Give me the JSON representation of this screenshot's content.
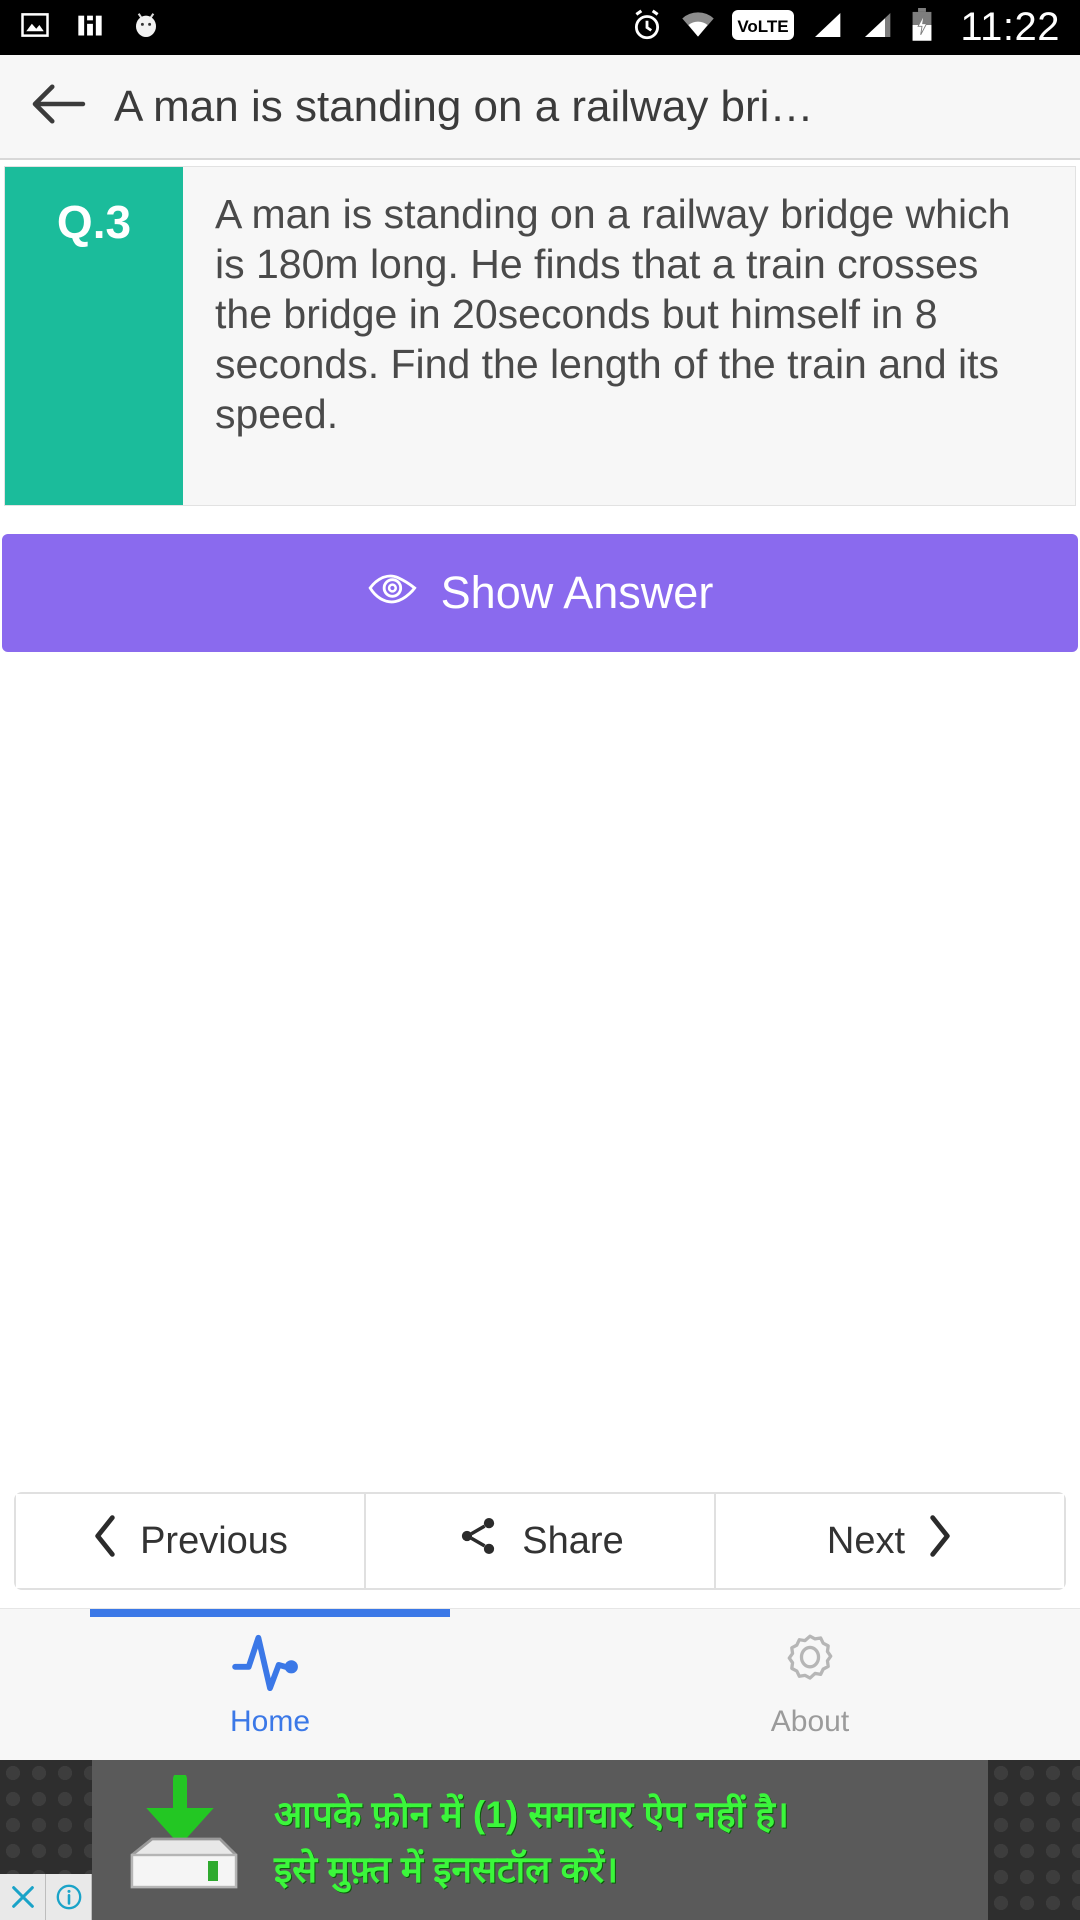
{
  "status_bar": {
    "time": "11:22",
    "left_icons": [
      "image-icon",
      "chart-icon",
      "android-mascot-icon"
    ],
    "right_icons": [
      "alarm-icon",
      "wifi-icon",
      "volte-icon",
      "signal-bars-1-icon",
      "signal-bars-2-icon",
      "battery-charging-icon"
    ],
    "volte_label": "VoLTE"
  },
  "header": {
    "back_icon": "arrow-left-icon",
    "title": "A man is standing on a railway bri…"
  },
  "question_card": {
    "number_label": "Q.3",
    "text": "A man is standing on a railway bridge which is 180m long. He finds that a train crosses the bridge in 20seconds but himself in 8 seconds. Find the length of the train and its speed.",
    "badge_color": "#1bbc9b",
    "background_color": "#f7f7f7"
  },
  "show_answer": {
    "label": "Show Answer",
    "icon": "eye-icon",
    "color": "#8a6aee"
  },
  "pager": {
    "previous_label": "Previous",
    "previous_icon": "chevron-left-icon",
    "share_label": "Share",
    "share_icon": "share-icon",
    "next_label": "Next",
    "next_icon": "chevron-right-icon"
  },
  "tabs": {
    "active": "Home",
    "items": [
      {
        "label": "Home",
        "icon": "pulse-icon",
        "color": "#3b78e7"
      },
      {
        "label": "About",
        "icon": "gear-icon",
        "color": "#9b9b9b"
      }
    ]
  },
  "ad": {
    "line1": "आपके फ़ोन में (1) समाचार ऐप नहीं है।",
    "line2": "इसे मुफ़्त में इनसटॉल करें।",
    "text_color": "#3bf73b",
    "close_icon": "close-icon",
    "info_icon": "info-icon",
    "art_icon": "download-to-drive-icon"
  }
}
